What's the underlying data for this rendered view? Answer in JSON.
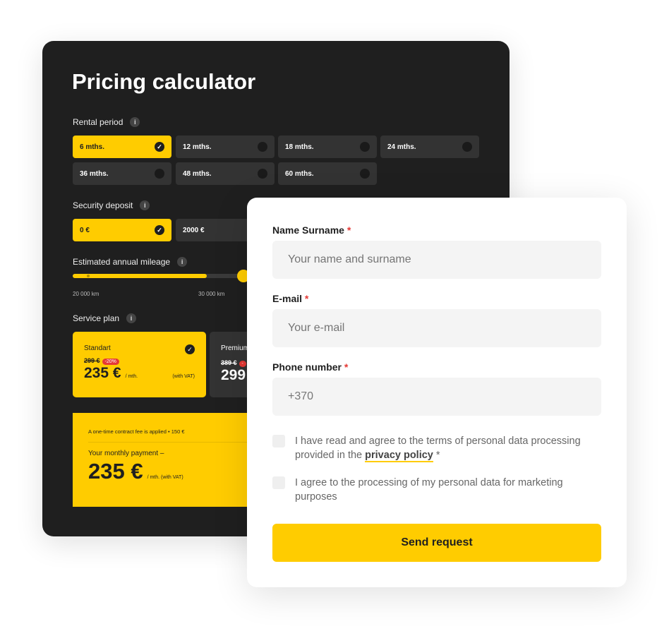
{
  "calculator": {
    "title": "Pricing calculator",
    "rental_label": "Rental period",
    "rental_options": [
      "6 mths.",
      "12 mths.",
      "18 mths.",
      "24 mths.",
      "36 mths.",
      "48 mths.",
      "60 mths."
    ],
    "deposit_label": "Security deposit",
    "deposit_options": [
      "0 €",
      "2000 €"
    ],
    "mileage_label": "Estimated annual mileage",
    "mileage_ticks": [
      "20 000 km",
      "30 000 km"
    ],
    "mileage_value": "30 000 km",
    "service_label": "Service plan",
    "plans": [
      {
        "name": "Standart",
        "old_price": "299 €",
        "discount": "-20%",
        "price": "235 €",
        "unit": "/ mth.",
        "vat": "(with VAT)"
      },
      {
        "name": "Premium",
        "old_price": "389 €",
        "discount": "-",
        "price": "299"
      }
    ],
    "fee_text": "A one-time contract fee is applied",
    "fee_sep": "•",
    "fee_value": "150 €",
    "monthly_label": "Your monthly payment –",
    "monthly_value": "235 €",
    "monthly_unit": "/ mth. (with VAT)",
    "info_icon": "i",
    "check_icon": "✓"
  },
  "form": {
    "name_label": "Name Surname",
    "name_placeholder": "Your name and surname",
    "email_label": "E-mail",
    "email_placeholder": "Your e-mail",
    "phone_label": "Phone number",
    "phone_value": "+370",
    "required": "*",
    "consent1_pre": "I have read and agree to the terms of personal data processing provided in the ",
    "consent1_link": "privacy policy",
    "consent1_post": " *",
    "consent2": "I agree to the processing of my personal data for marketing purposes",
    "submit": "Send request"
  },
  "colors": {
    "accent": "#ffcc00",
    "dark": "#1f1f1f",
    "required": "#e53935"
  }
}
